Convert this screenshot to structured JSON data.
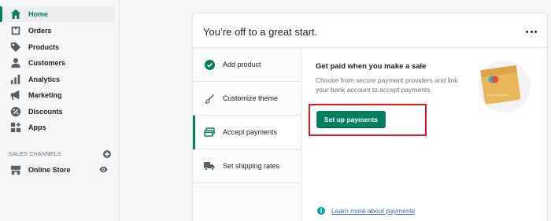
{
  "sidebar": {
    "items": [
      {
        "label": "Home",
        "icon": "home-icon",
        "active": true
      },
      {
        "label": "Orders",
        "icon": "orders-icon"
      },
      {
        "label": "Products",
        "icon": "tag-icon"
      },
      {
        "label": "Customers",
        "icon": "person-icon"
      },
      {
        "label": "Analytics",
        "icon": "bar-chart-icon"
      },
      {
        "label": "Marketing",
        "icon": "megaphone-icon"
      },
      {
        "label": "Discounts",
        "icon": "discount-icon"
      },
      {
        "label": "Apps",
        "icon": "apps-grid-icon"
      }
    ],
    "sales_channels_label": "SALES CHANNELS",
    "online_store_label": "Online Store"
  },
  "card": {
    "title": "You’re off to a great start.",
    "steps": [
      {
        "label": "Add product",
        "icon": "check-circle-icon",
        "done": true
      },
      {
        "label": "Customize theme",
        "icon": "brush-icon"
      },
      {
        "label": "Accept payments",
        "icon": "card-icon",
        "active": true
      },
      {
        "label": "Set shipping rates",
        "icon": "truck-icon"
      }
    ],
    "content": {
      "title": "Get paid when you make a sale",
      "description": "Choose from secure payment providers and link your bank account to accept payments.",
      "button_label": "Set up payments",
      "learn_more": "Learn more about payments"
    }
  },
  "colors": {
    "accent": "#008060",
    "highlight": "#e3161f",
    "link": "#2c6ecb",
    "card_illustration": "#e8b75a"
  }
}
